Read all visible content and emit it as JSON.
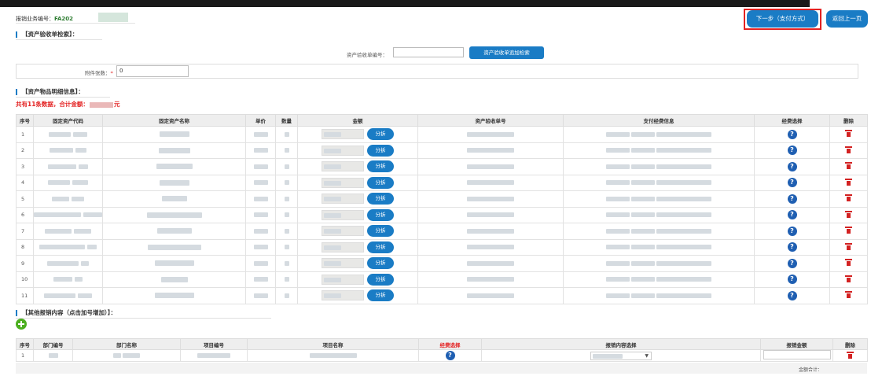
{
  "header": {
    "biz_no_label": "报销业务编号：",
    "biz_no_value": "FA202"
  },
  "buttons": {
    "next": "下一步（支付方式）",
    "back": "返回上一页"
  },
  "search_section": {
    "title": "【资产验收单检索】：",
    "field_label": "资产验收单编号：",
    "search_button": "资产验收单追加检索"
  },
  "attachment": {
    "label": "附件张数：",
    "required_mark": "*",
    "value": "0"
  },
  "detail_section": {
    "title": "【资产物品明细信息】：",
    "summary_prefix": "共有11条数据，合计金额：",
    "summary_suffix": "元"
  },
  "detail_table": {
    "columns": [
      "序号",
      "固定资产代码",
      "固定资产名称",
      "单价",
      "数量",
      "金额",
      "资产验收单号",
      "支付经费信息",
      "经费选择",
      "删除"
    ],
    "split_label": "分拆",
    "help_symbol": "?",
    "rows": [
      "1",
      "2",
      "3",
      "4",
      "5",
      "6",
      "7",
      "8",
      "9",
      "10",
      "11"
    ]
  },
  "other_section": {
    "title": "【其他报销内容（点击加号增加）】："
  },
  "other_table": {
    "columns": [
      "序号",
      "部门编号",
      "部门名称",
      "项目编号",
      "项目名称",
      "经费选择",
      "报销内容选择",
      "报销金额",
      "删除"
    ],
    "rows": [
      {
        "seq": "1",
        "select_arrow": "▼"
      }
    ],
    "help_symbol": "?"
  },
  "total": {
    "label": "金额合计："
  },
  "colors": {
    "primary": "#1a7cc5",
    "danger": "#e32222",
    "success": "#2e7d32",
    "add": "#4caf1f",
    "help": "#1f5fb2"
  },
  "icons": [
    "help-icon",
    "trash-icon",
    "add-icon",
    "dropdown-arrow-icon"
  ]
}
